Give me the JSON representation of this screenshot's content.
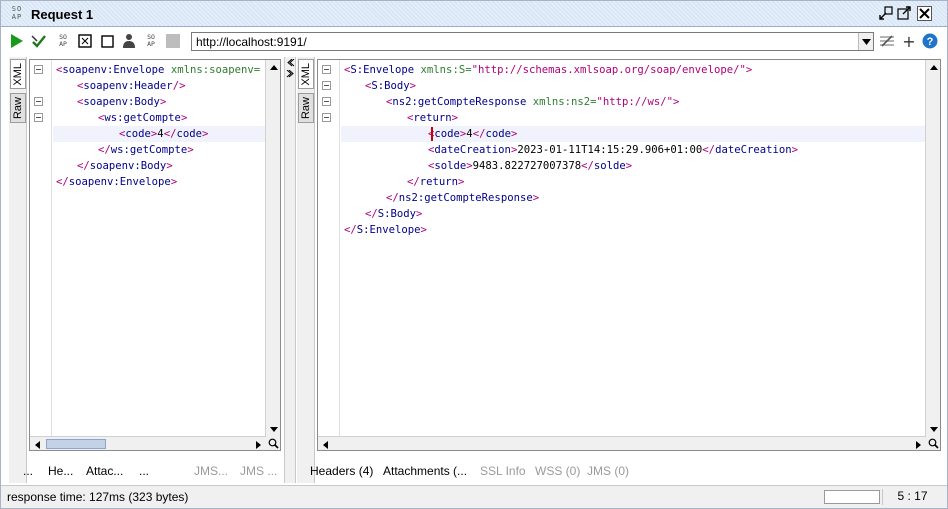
{
  "window": {
    "title": "Request 1",
    "logo_text": "SOAP"
  },
  "toolbar": {
    "url": "http://localhost:9191/"
  },
  "request": {
    "tabs": [
      "XML",
      "Raw"
    ],
    "lines": [
      {
        "indent": 0,
        "open": "<",
        "tag": "soapenv:Envelope",
        "attr": " xmlns:soapenv=",
        "val": "",
        "close": "",
        "text": "",
        "endopen": "",
        "endtag": "",
        "endclose": ""
      },
      {
        "indent": 1,
        "open": "<",
        "tag": "soapenv:Header",
        "attr": "",
        "val": "",
        "close": "/>",
        "text": "",
        "endopen": "",
        "endtag": "",
        "endclose": ""
      },
      {
        "indent": 1,
        "open": "<",
        "tag": "soapenv:Body",
        "attr": "",
        "val": "",
        "close": ">",
        "text": "",
        "endopen": "",
        "endtag": "",
        "endclose": ""
      },
      {
        "indent": 2,
        "open": "<",
        "tag": "ws:getCompte",
        "attr": "",
        "val": "",
        "close": ">",
        "text": "",
        "endopen": "",
        "endtag": "",
        "endclose": ""
      },
      {
        "indent": 3,
        "open": "<",
        "tag": "code",
        "attr": "",
        "val": "",
        "close": ">",
        "text": "4",
        "endopen": "</",
        "endtag": "code",
        "endclose": ">"
      },
      {
        "indent": 2,
        "open": "</",
        "tag": "ws:getCompte",
        "attr": "",
        "val": "",
        "close": ">",
        "text": "",
        "endopen": "",
        "endtag": "",
        "endclose": ""
      },
      {
        "indent": 1,
        "open": "</",
        "tag": "soapenv:Body",
        "attr": "",
        "val": "",
        "close": ">",
        "text": "",
        "endopen": "",
        "endtag": "",
        "endclose": ""
      },
      {
        "indent": 0,
        "open": "</",
        "tag": "soapenv:Envelope",
        "attr": "",
        "val": "",
        "close": ">",
        "text": "",
        "endopen": "",
        "endtag": "",
        "endclose": ""
      }
    ],
    "bottom_tabs": [
      "...",
      "He...",
      "Attac...",
      "...",
      "JMS...",
      "JMS ..."
    ]
  },
  "response": {
    "tabs": [
      "XML",
      "Raw"
    ],
    "lines": [
      {
        "indent": 0,
        "open": "<",
        "tag": "S:Envelope",
        "attr": " xmlns:S=",
        "val": "\"http://schemas.xmlsoap.org/soap/envelope/\"",
        "close": ">",
        "text": "",
        "endopen": "",
        "endtag": "",
        "endclose": ""
      },
      {
        "indent": 1,
        "open": "<",
        "tag": "S:Body",
        "attr": "",
        "val": "",
        "close": ">",
        "text": "",
        "endopen": "",
        "endtag": "",
        "endclose": ""
      },
      {
        "indent": 2,
        "open": "<",
        "tag": "ns2:getCompteResponse",
        "attr": " xmlns:ns2=",
        "val": "\"http://ws/\"",
        "close": ">",
        "text": "",
        "endopen": "",
        "endtag": "",
        "endclose": ""
      },
      {
        "indent": 3,
        "open": "<",
        "tag": "return",
        "attr": "",
        "val": "",
        "close": ">",
        "text": "",
        "endopen": "",
        "endtag": "",
        "endclose": ""
      },
      {
        "indent": 4,
        "open": "<",
        "tag": "code",
        "attr": "",
        "val": "",
        "close": ">",
        "text": "4",
        "endopen": "</",
        "endtag": "code",
        "endclose": ">"
      },
      {
        "indent": 4,
        "open": "<",
        "tag": "dateCreation",
        "attr": "",
        "val": "",
        "close": ">",
        "text": "2023-01-11T14:15:29.906+01:00",
        "endopen": "</",
        "endtag": "dateCreation",
        "endclose": ">"
      },
      {
        "indent": 4,
        "open": "<",
        "tag": "solde",
        "attr": "",
        "val": "",
        "close": ">",
        "text": "9483.822727007378",
        "endopen": "</",
        "endtag": "solde",
        "endclose": ">"
      },
      {
        "indent": 3,
        "open": "</",
        "tag": "return",
        "attr": "",
        "val": "",
        "close": ">",
        "text": "",
        "endopen": "",
        "endtag": "",
        "endclose": ""
      },
      {
        "indent": 2,
        "open": "</",
        "tag": "ns2:getCompteResponse",
        "attr": "",
        "val": "",
        "close": ">",
        "text": "",
        "endopen": "",
        "endtag": "",
        "endclose": ""
      },
      {
        "indent": 1,
        "open": "</",
        "tag": "S:Body",
        "attr": "",
        "val": "",
        "close": ">",
        "text": "",
        "endopen": "",
        "endtag": "",
        "endclose": ""
      },
      {
        "indent": 0,
        "open": "</",
        "tag": "S:Envelope",
        "attr": "",
        "val": "",
        "close": ">",
        "text": "",
        "endopen": "",
        "endtag": "",
        "endclose": ""
      }
    ],
    "bottom_tabs": [
      "Headers (4)",
      "Attachments (...",
      "SSL Info",
      "WSS (0)",
      "JMS (0)"
    ]
  },
  "status": {
    "response_time": "response time: 127ms (323 bytes)",
    "cursor_position": "5 : 17"
  },
  "colors": {
    "accent": "#00008b",
    "bracket": "#b0007a",
    "attribute": "#2e7d32",
    "run_green": "#1a9a1a"
  }
}
